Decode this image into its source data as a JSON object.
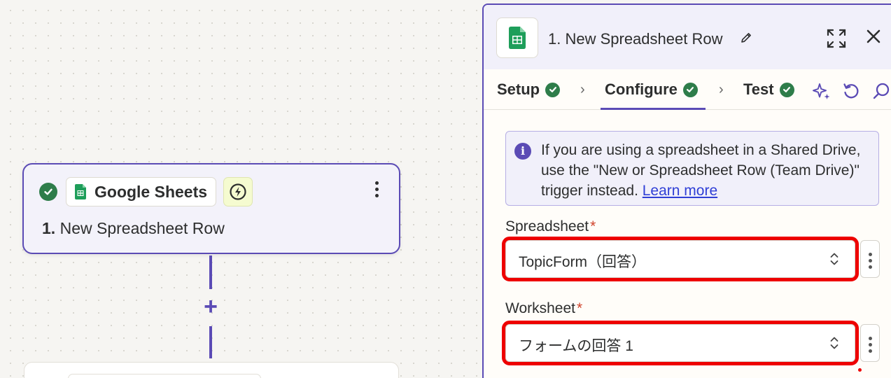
{
  "canvas": {
    "trigger_card": {
      "app_name": "Google Sheets",
      "step_number": "1.",
      "step_title": "New Spreadsheet Row",
      "status_icon": "check-circle-icon",
      "trigger_badge_icon": "lightning-bolt-icon"
    },
    "add_step_icon": "plus-icon"
  },
  "panel": {
    "title": "1. New Spreadsheet Row",
    "icons": [
      "google-sheets-icon",
      "pencil-icon",
      "expand-icon",
      "close-icon"
    ],
    "tabs": [
      {
        "label": "Setup",
        "complete": true
      },
      {
        "label": "Configure",
        "complete": true,
        "active": true
      },
      {
        "label": "Test",
        "complete": true
      }
    ],
    "toolbar_icons": [
      "sparkle-icon",
      "undo-icon",
      "search-icon"
    ],
    "info": {
      "text": "If you are using a spreadsheet in a Shared Drive, use the \"New or Spreadsheet Row (Team Drive)\" trigger instead. ",
      "link": "Learn more"
    },
    "fields": {
      "spreadsheet": {
        "label": "Spreadsheet",
        "required_mark": "*",
        "value": "TopicForm（回答）"
      },
      "worksheet": {
        "label": "Worksheet",
        "required_mark": "*",
        "value": "フォームの回答 1"
      }
    }
  },
  "colors": {
    "accent": "#5b4bb5",
    "success": "#2e7d4a",
    "highlight": "#ee0000",
    "link": "#2f3fd6"
  }
}
